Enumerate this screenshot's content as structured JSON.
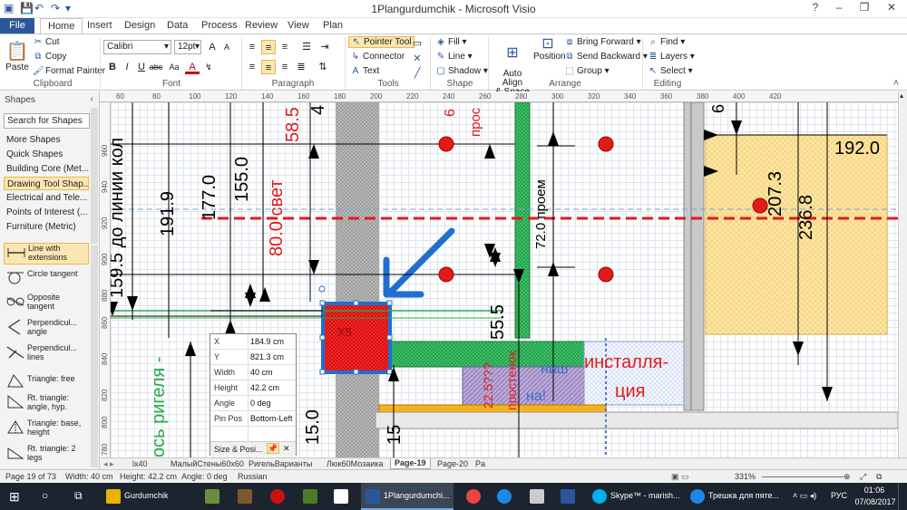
{
  "window": {
    "title": "1Plangurdumchik - Microsoft Visio",
    "controls": [
      "?",
      "–",
      "❐",
      "✕"
    ]
  },
  "ribbon_tabs": [
    "File",
    "Home",
    "Insert",
    "Design",
    "Data",
    "Process",
    "Review",
    "View",
    "Plan"
  ],
  "ribbon": {
    "clipboard": {
      "paste": "Paste",
      "cut": "Cut",
      "copy": "Copy",
      "format_painter": "Format Painter",
      "label": "Clipboard"
    },
    "font": {
      "family": "Calibri",
      "size": "12pt",
      "label": "Font"
    },
    "paragraph": {
      "label": "Paragraph"
    },
    "tools": {
      "pointer": "Pointer Tool",
      "connector": "Connector",
      "text": "Text",
      "label": "Tools"
    },
    "shape": {
      "fill": "Fill",
      "line": "Line",
      "shadow": "Shadow",
      "label": "Shape"
    },
    "arrange": {
      "auto_align": "Auto Align\n& Space",
      "position": "Position",
      "bring_forward": "Bring Forward",
      "send_backward": "Send Backward",
      "group": "Group",
      "label": "Arrange"
    },
    "editing": {
      "find": "Find",
      "layers": "Layers",
      "select": "Select",
      "label": "Editing"
    }
  },
  "shapes_panel": {
    "title": "Shapes",
    "search_placeholder": "Search for Shapes",
    "stencils": [
      "More Shapes",
      "Quick Shapes",
      "Building Core (Met...",
      "Drawing Tool Shap...",
      "Electrical and Tele...",
      "Points of Interest (...",
      "Furniture (Metric)"
    ],
    "active_stencil_index": 3,
    "stencil_shapes": [
      "Line with extensions",
      "Circle tangent",
      "Opposite tangent",
      "Perpendicul... angle",
      "Perpendicul... lines",
      "Triangle: free",
      "Rt. triangle: angle, hyp.",
      "Triangle: base, height",
      "Rt. triangle: 2 legs"
    ]
  },
  "rulers": {
    "horizontal": [
      "60",
      "80",
      "100",
      "120",
      "140",
      "160",
      "180",
      "200",
      "220",
      "240",
      "260",
      "280",
      "300",
      "320",
      "340",
      "360",
      "380",
      "400",
      "420"
    ],
    "vertical": [
      "960",
      "940",
      "920",
      "900",
      "880",
      "860",
      "840",
      "820",
      "800",
      "780"
    ]
  },
  "drawing": {
    "labels": {
      "d159": "159.5 до линии кол",
      "d191": "191.9",
      "d177": "177.0",
      "d155": "155.0",
      "d80": "80.0 свет",
      "d58": "58.5",
      "d4": "4",
      "d6a": "6",
      "pros": "прос",
      "d72": "72.0 проем",
      "d55": "55.5",
      "d6b": "6",
      "d192": "192.0",
      "d207": "207.3",
      "d236": "236.8",
      "d15a": "15.0",
      "d15b": "15",
      "rigel": "ось ригеля -",
      "install": "инсталля-",
      "install2": "ция",
      "q22": "22.5???",
      "stenok": "простенок",
      "nish": "ниш",
      "na": "на!",
      "xs": "X5"
    }
  },
  "size_position": {
    "rows": [
      {
        "k": "X",
        "v": "184.9 cm"
      },
      {
        "k": "Y",
        "v": "821.3 cm"
      },
      {
        "k": "Width",
        "v": "40 cm"
      },
      {
        "k": "Height",
        "v": "42.2 cm"
      },
      {
        "k": "Angle",
        "v": "0 deg"
      },
      {
        "k": "Pin Pos",
        "v": "Bottom-Left"
      }
    ],
    "title": "Size & Posi..."
  },
  "page_tabs": [
    "lx40",
    "МалыйСтены60х60",
    "РигельВарианты",
    "Люк60Мозаика",
    "Page-19",
    "Page-20",
    "Pa"
  ],
  "active_page_tab": "Page-19",
  "status": {
    "page": "Page 19 of 73",
    "width": "Width: 40 cm",
    "height": "Height: 42.2 cm",
    "angle": "Angle: 0 deg",
    "language": "Russian",
    "zoom": "331%"
  },
  "taskbar": {
    "items": [
      {
        "label": "Gurdumchik",
        "color": "#e8b400"
      },
      {
        "label": "1Plangurdumchi...",
        "color": "#2b579a",
        "active": true
      },
      {
        "label": "Skype™ - marish...",
        "color": "#00aff0"
      },
      {
        "label": "Трешка для пяте...",
        "color": "#1e88e5"
      }
    ],
    "lang": "РУС",
    "time": "01:06",
    "date": "07/08/2017"
  }
}
